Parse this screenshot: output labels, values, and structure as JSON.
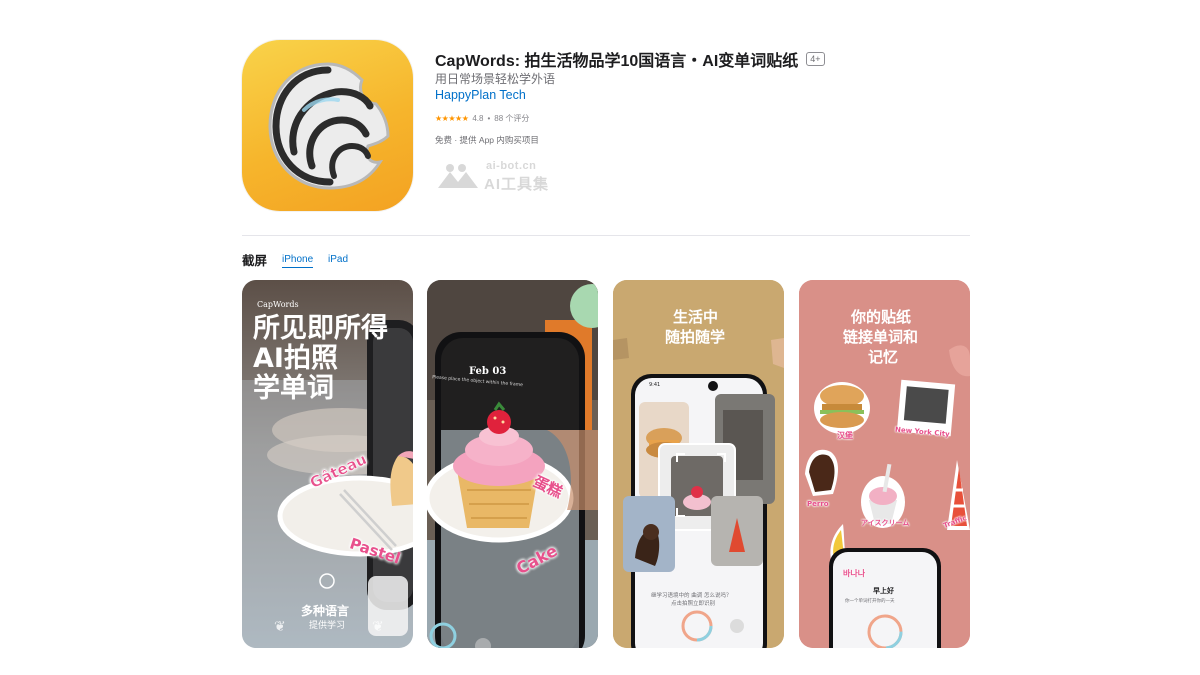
{
  "app": {
    "title": "CapWords: 拍生活物品学10国语言・AI变单词贴纸",
    "age_rating": "4+",
    "subtitle": "用日常场景轻松学外语",
    "developer": "HappyPlan Tech",
    "stars": "★★★★★",
    "rating": "4.8",
    "rating_sep": "•",
    "rating_count": "88 个评分",
    "price": "免费 · 提供 App 内购买项目"
  },
  "watermark": {
    "url": "ai-bot.cn",
    "name": "AI工具集"
  },
  "screenshots": {
    "section_title": "截屏",
    "tabs": [
      {
        "label": "iPhone",
        "selected": true
      },
      {
        "label": "iPad",
        "selected": false
      }
    ],
    "shot1": {
      "brand": "CapWords",
      "headline1": "所见即所得",
      "headline2": "AI拍照",
      "headline3": "学单词",
      "sticker1": "Gâteau",
      "sticker2": "Pastel",
      "footer1": "多种语言",
      "footer2": "提供学习"
    },
    "shot2": {
      "date": "Feb 03",
      "hint": "Please place the object within the frame",
      "sticker1": "蛋糕",
      "sticker2": "Cake"
    },
    "shot3": {
      "headline1": "生活中",
      "headline2": "随拍随学",
      "time": "9:41",
      "caption1": "继学习语境中的 曲调 怎么说吗？",
      "caption2": "点击拍照立即识别"
    },
    "shot4": {
      "headline1": "你的贴纸",
      "headline2": "链接单词和",
      "headline3": "记忆",
      "label_burger": "汉堡",
      "label_city": "New York City",
      "label_dog": "Perro",
      "label_icecream": "アイスクリーム",
      "label_traffic": "Traffic",
      "label_banana": "바나나",
      "phone_title": "早上好",
      "phone_sub": "你一个单词打开你的一天"
    }
  },
  "colors": {
    "link_blue": "#0070c9",
    "star_orange": "#ff9500",
    "icon_yellow": "#f6b52c",
    "shot3_bg": "#c9a870",
    "shot4_bg": "#d99088"
  }
}
